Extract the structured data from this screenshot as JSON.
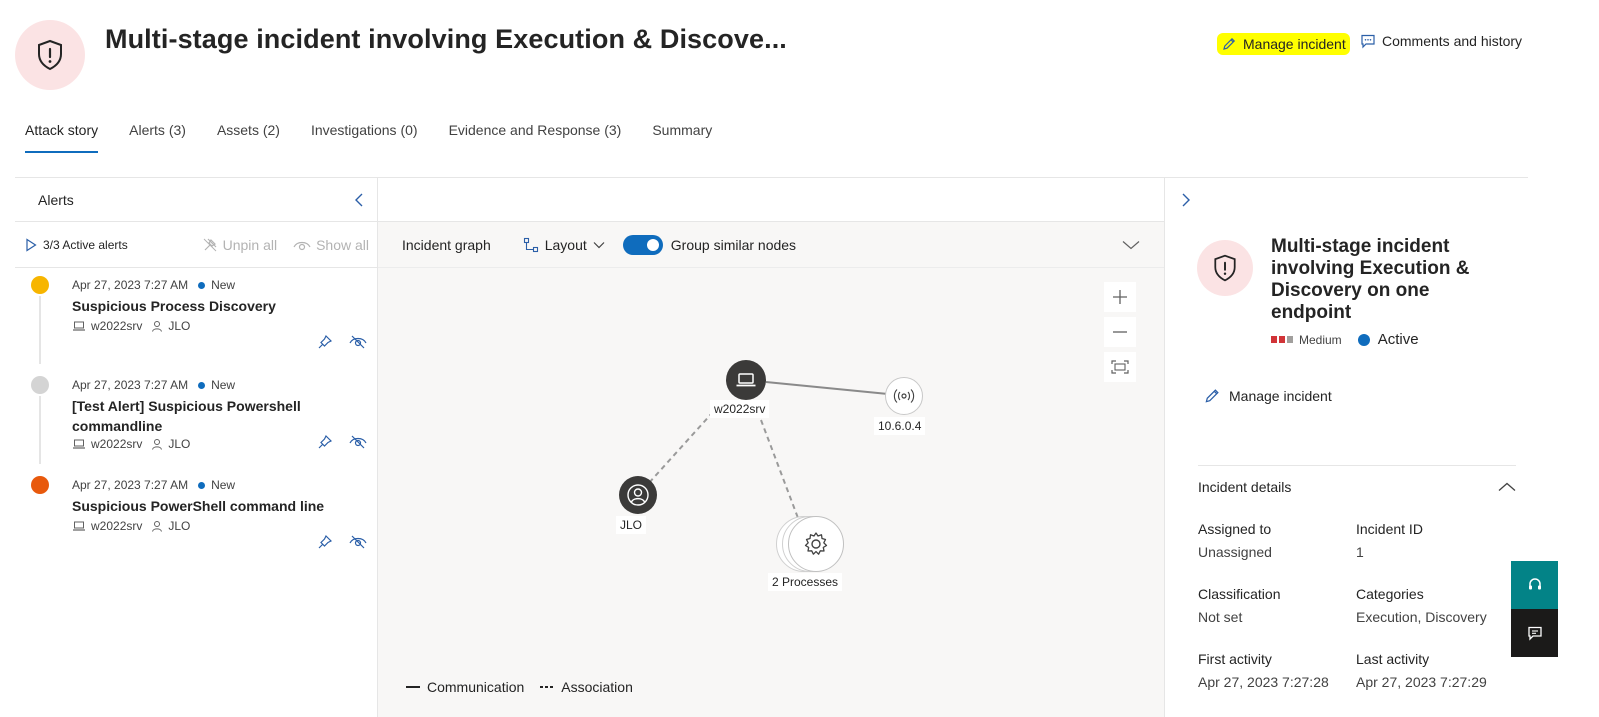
{
  "header": {
    "title": "Multi-stage incident involving Execution & Discove...",
    "manage_incident": "Manage incident",
    "comments_history": "Comments and history"
  },
  "tabs": [
    {
      "label": "Attack story",
      "active": true
    },
    {
      "label": "Alerts (3)"
    },
    {
      "label": "Assets (2)"
    },
    {
      "label": "Investigations (0)"
    },
    {
      "label": "Evidence and Response (3)"
    },
    {
      "label": "Summary"
    }
  ],
  "alerts_panel": {
    "title": "Alerts",
    "active_alerts": "3/3 Active alerts",
    "unpin_all": "Unpin all",
    "show_all": "Show all",
    "items": [
      {
        "time": "Apr 27, 2023 7:27 AM",
        "status": "New",
        "name": "Suspicious Process Discovery",
        "device": "w2022srv",
        "user": "JLO",
        "color": "#f7b500"
      },
      {
        "time": "Apr 27, 2023 7:27 AM",
        "status": "New",
        "name": "[Test Alert] Suspicious Powershell commandline",
        "device": "w2022srv",
        "user": "JLO",
        "color": "#d4d4d4"
      },
      {
        "time": "Apr 27, 2023 7:27 AM",
        "status": "New",
        "name": "Suspicious PowerShell command line",
        "device": "w2022srv",
        "user": "JLO",
        "color": "#e8590c"
      }
    ]
  },
  "graph": {
    "label": "Incident graph",
    "layout": "Layout",
    "group_similar": "Group similar nodes",
    "group_similar_on": true,
    "nodes": {
      "device": "w2022srv",
      "ip": "10.6.0.4",
      "user": "JLO",
      "processes": "2 Processes"
    },
    "legend": {
      "communication": "Communication",
      "association": "Association"
    }
  },
  "details": {
    "title": "Multi-stage incident involving Execution & Discovery on one endpoint",
    "severity": "Medium",
    "status": "Active",
    "manage_incident": "Manage incident",
    "section_title": "Incident details",
    "fields": [
      {
        "key": "Assigned to",
        "value": "Unassigned"
      },
      {
        "key": "Incident ID",
        "value": "1"
      },
      {
        "key": "Classification",
        "value": "Not set"
      },
      {
        "key": "Categories",
        "value": "Execution, Discovery"
      },
      {
        "key": "First activity",
        "value": "Apr 27, 2023 7:27:28"
      },
      {
        "key": "Last activity",
        "value": "Apr 27, 2023 7:27:29"
      }
    ]
  },
  "colors": {
    "accent": "#0f6cbd",
    "severity_red": "#d13438",
    "highlight": "#ffff00",
    "fab_teal": "#038387",
    "fab_dark": "#1b1a19"
  }
}
